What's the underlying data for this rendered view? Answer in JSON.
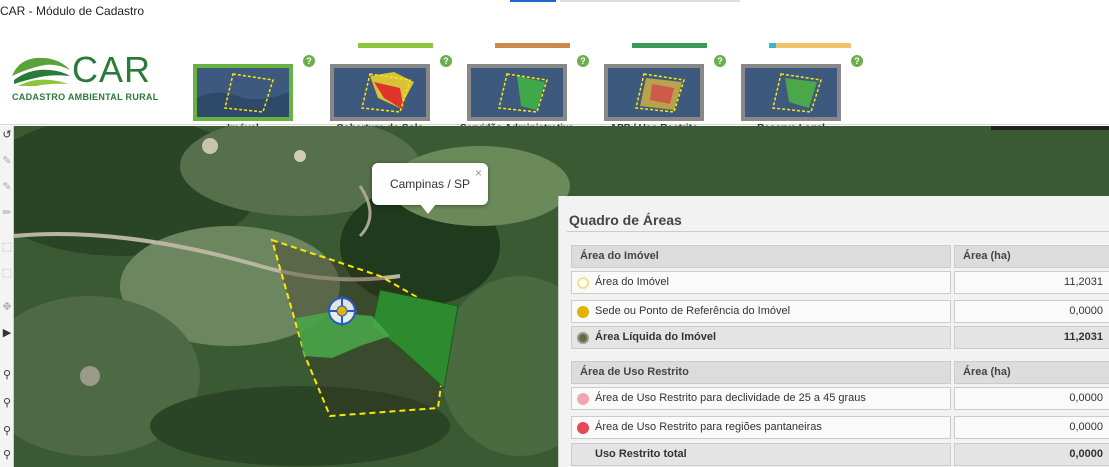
{
  "window": {
    "title": "CAR - Módulo de Cadastro"
  },
  "logo": {
    "text": "CAR",
    "subtitle": "CADASTRO AMBIENTAL RURAL"
  },
  "steps": [
    {
      "label": "Imóvel",
      "bar_color": "",
      "active": true
    },
    {
      "label": "Cobertura do Solo",
      "bar_color": "#8cc63f",
      "active": false
    },
    {
      "label": "Servidão Administrativa",
      "bar_color": "#c98a4b",
      "active": false
    },
    {
      "label": "APP / Uso Restrito",
      "bar_color": "#3a9a5a",
      "active": false
    },
    {
      "label": "Reserva Legal",
      "bar_color": "#33b5d6",
      "active": false
    }
  ],
  "extra_bar_color": "#f5c06a",
  "help_glyph": "?",
  "map": {
    "popup": {
      "text": "Campinas / SP",
      "close_glyph": "×"
    },
    "toolbar_icons": [
      "undo-icon",
      "pencil-icon",
      "edit-icon",
      "draw-icon",
      "point-icon",
      "select-icon",
      "zoom-in-icon",
      "zoom-out-icon",
      "zoom-icon"
    ]
  },
  "quadro": {
    "title": "Quadro de Áreas",
    "imovel_section": {
      "header": "Área do Imóvel",
      "header_value": "Área (ha)",
      "rows": [
        {
          "label": "Área do Imóvel",
          "value": "11,2031",
          "dot_color": "#f5e08a"
        },
        {
          "label": "Sede ou Ponto de Referência do Imóvel",
          "value": "0,0000",
          "dot_color": "#e0b400"
        },
        {
          "label": "Área Líquida do Imóvel",
          "value": "11,2031",
          "dot_color": "#6b6b3a"
        }
      ]
    },
    "restrito_section": {
      "header": "Área de Uso Restrito",
      "header_value": "Área (ha)",
      "rows": [
        {
          "label": "Área de Uso Restrito para declividade de 25 a 45 graus",
          "value": "0,0000",
          "dot_color": "#f4a6b0"
        },
        {
          "label": "Área de Uso Restrito para regiões pantaneiras",
          "value": "0,0000",
          "dot_color": "#e8475a"
        }
      ],
      "total": {
        "label": "Uso Restrito total",
        "value": "0,0000"
      }
    }
  }
}
